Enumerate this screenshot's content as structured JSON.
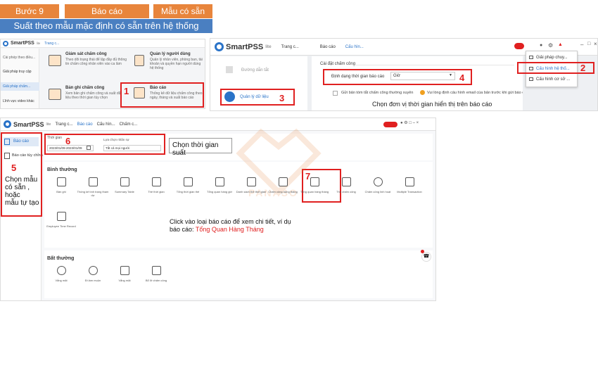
{
  "header": {
    "step": "Bước 9",
    "report": "Báo cáo",
    "template": "Mẫu có sẵn",
    "subtitle": "Suất theo mẫu mặc định có sẵn trên hệ thống"
  },
  "topleft": {
    "app": "SmartPSS",
    "lite": "lite",
    "tab": "Trang c...",
    "sidebar": [
      "Cài phép theo điều...",
      "Giải pháp truy cập",
      "Giải pháp chấm...",
      "Lĩnh vực video khác"
    ],
    "cards": [
      {
        "title": "Giám sát chấm công",
        "desc": "Theo dõi trạng thái để lập đầy đủ thông tin chấm công nhân viên vào ca làm"
      },
      {
        "title": "Quản lý người dùng",
        "desc": "Quản lý nhân viên, phòng ban, tài khoản và quyền hạn người dùng hệ thống"
      },
      {
        "title": "Bản ghi chấm công",
        "desc": "Xem bản ghi chấm công và xuất dữ liệu theo thời gian tùy chọn"
      },
      {
        "title": "Báo cáo",
        "desc": "Thống kê dữ liệu chấm công theo ngày, tháng và xuất báo cáo"
      }
    ],
    "step1": "1"
  },
  "topright": {
    "app": "SmartPSS",
    "lite": "lite",
    "tab_home": "Trang c...",
    "tab_report": "Báo cáo",
    "tab_config": "Cấu hìn...",
    "left_items": [
      "Đường dẫn tắt",
      "Quản lý dữ liệu"
    ],
    "section": "Cài đặt chấm công",
    "format_label": "Định dạng thời gian báo cáo",
    "format_value": "Giờ",
    "check_text": "Gửi bản tóm tắt chấm công thường xuyên",
    "warn_text": "Vui lòng định cấu hình email của bản trước khi gửi báo cáo.",
    "menu": [
      "Giải pháp chuy...",
      "Cấu hình hệ thố...",
      "Cấu hình cơ sở ..."
    ],
    "step2": "2",
    "step3": "3",
    "step4": "4",
    "note": "Chọn đơn vị thời gian hiển thị trên báo cáo"
  },
  "bottom": {
    "app": "SmartPSS",
    "lite": "lite",
    "tabs": [
      "Trang c...",
      "Báo cáo",
      "Cấu hìn...",
      "Chấm c..."
    ],
    "side": [
      "Báo cáo",
      "Báo cáo tùy chỉnh"
    ],
    "step5": "5",
    "note5": "Chọn mẫu\ncó sẵn ,\nhoặc\nmẫu tự tạo",
    "time_label": "Thời gian",
    "time_value": "2023/01/09-2023/01/09",
    "filter_label": "Lựa chọn nhân sự",
    "filter_value": "Tất cả mọi người",
    "step6": "6",
    "note6": "Chọn thời gian suất",
    "normal_title": "Bình thường",
    "normal": [
      "Bản ghi",
      "Thống kê tình trạng tham dự",
      "Summary Table",
      "Thẻ thời gian",
      "Tổng thời gian thẻ",
      "Tổng quan hàng giờ",
      "Danh sách thẻ thời gian",
      "Chấm công hàng tháng",
      "Tổng quan hàng tháng",
      "Thẻ chấm công",
      "Chấm công linh hoạt",
      "Multiple Transaction"
    ],
    "employee": "Employee Time Record",
    "step7": "7",
    "note7a": "Click vào loại báo cáo để xem chi tiết, ví dụ báo cáo: ",
    "note7b": "Tổng Quan Hàng Tháng",
    "abn_title": "Bất thường",
    "abn": [
      "Vắng mặt",
      "Đi làm muộn",
      "Vắng mặt",
      "Bổ lỡ chấm công"
    ],
    "watermark": "PANASO"
  },
  "colors": {
    "accent_orange": "#e8853c",
    "accent_blue": "#4a7fc1",
    "highlight_red": "#e02020"
  }
}
